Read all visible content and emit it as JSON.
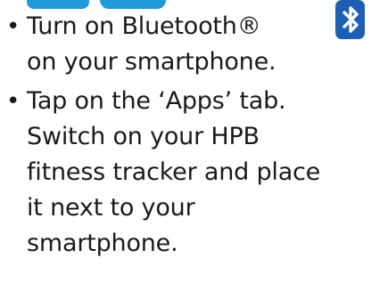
{
  "bullets": [
    {
      "bullet_char": "•",
      "lines": [
        "Turn on Bluetooth®",
        "on your smartphone."
      ],
      "icon": "bluetooth-icon"
    },
    {
      "bullet_char": "•",
      "lines": [
        "Tap on the ‘Apps’ tab.",
        "Switch on your HPB",
        "fitness tracker and place",
        "it next to your",
        "smartphone."
      ]
    }
  ],
  "colors": {
    "text": "#1a1a1a",
    "heading_accent": "#1e9bd7",
    "bluetooth_badge": "#1d5fb4",
    "bluetooth_glyph": "#ffffff"
  }
}
